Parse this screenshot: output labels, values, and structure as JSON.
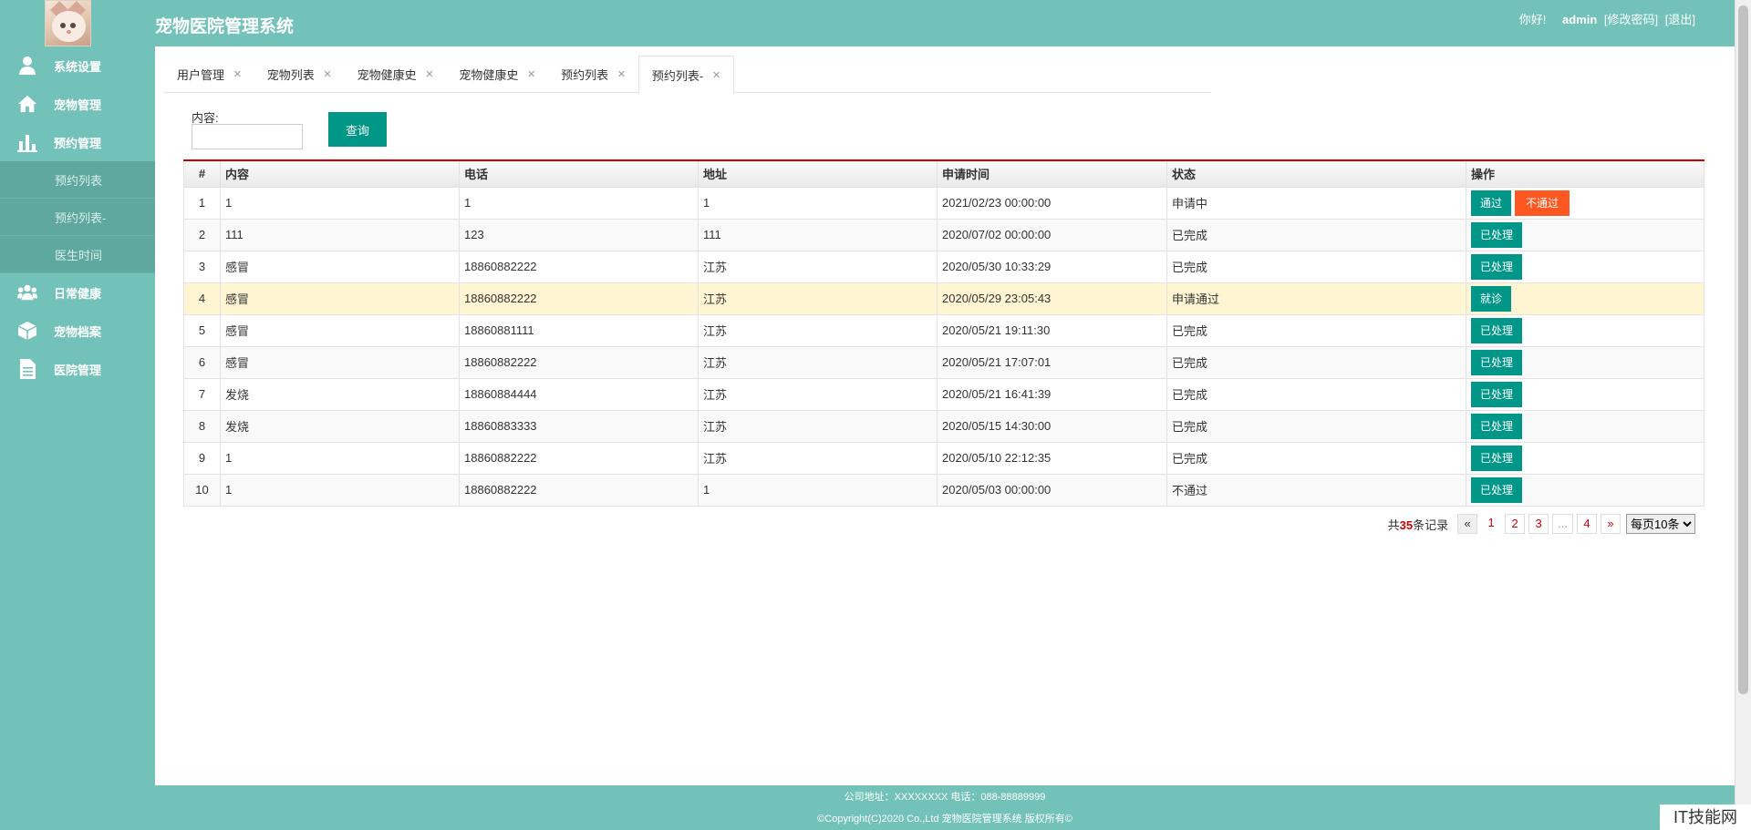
{
  "header": {
    "title": "宠物医院管理系统",
    "greeting": "你好!",
    "username": "admin",
    "change_password": "[修改密码]",
    "logout": "[退出]"
  },
  "sidebar": {
    "items": [
      {
        "label": "系统设置",
        "icon": "user-icon"
      },
      {
        "label": "宠物管理",
        "icon": "home-icon"
      },
      {
        "label": "预约管理",
        "icon": "bar-chart-icon"
      },
      {
        "label": "日常健康",
        "icon": "group-icon"
      },
      {
        "label": "宠物档案",
        "icon": "cube-icon"
      },
      {
        "label": "医院管理",
        "icon": "document-icon"
      }
    ],
    "subitems": [
      "预约列表",
      "预约列表-",
      "医生时间"
    ]
  },
  "tabs": [
    {
      "label": "用户管理"
    },
    {
      "label": "宠物列表"
    },
    {
      "label": "宠物健康史"
    },
    {
      "label": "宠物健康史"
    },
    {
      "label": "预约列表"
    },
    {
      "label": "预约列表-"
    }
  ],
  "search": {
    "label": "内容:",
    "value": "",
    "button": "查询"
  },
  "table": {
    "headers": [
      "#",
      "内容",
      "电话",
      "地址",
      "申请时间",
      "状态",
      "操作"
    ],
    "rows": [
      {
        "no": "1",
        "content": "1",
        "phone": "1",
        "address": "1",
        "time": "2021/02/23 00:00:00",
        "status": "申请中",
        "actions": [
          "通过",
          "不通过"
        ]
      },
      {
        "no": "2",
        "content": "111",
        "phone": "123",
        "address": "111",
        "time": "2020/07/02 00:00:00",
        "status": "已完成",
        "actions": [
          "已处理"
        ]
      },
      {
        "no": "3",
        "content": "感冒",
        "phone": "18860882222",
        "address": "江苏",
        "time": "2020/05/30 10:33:29",
        "status": "已完成",
        "actions": [
          "已处理"
        ]
      },
      {
        "no": "4",
        "content": "感冒",
        "phone": "18860882222",
        "address": "江苏",
        "time": "2020/05/29 23:05:43",
        "status": "申请通过",
        "actions": [
          "就诊"
        ]
      },
      {
        "no": "5",
        "content": "感冒",
        "phone": "18860881111",
        "address": "江苏",
        "time": "2020/05/21 19:11:30",
        "status": "已完成",
        "actions": [
          "已处理"
        ]
      },
      {
        "no": "6",
        "content": "感冒",
        "phone": "18860882222",
        "address": "江苏",
        "time": "2020/05/21 17:07:01",
        "status": "已完成",
        "actions": [
          "已处理"
        ]
      },
      {
        "no": "7",
        "content": "发烧",
        "phone": "18860884444",
        "address": "江苏",
        "time": "2020/05/21 16:41:39",
        "status": "已完成",
        "actions": [
          "已处理"
        ]
      },
      {
        "no": "8",
        "content": "发烧",
        "phone": "18860883333",
        "address": "江苏",
        "time": "2020/05/15 14:30:00",
        "status": "已完成",
        "actions": [
          "已处理"
        ]
      },
      {
        "no": "9",
        "content": "1",
        "phone": "18860882222",
        "address": "江苏",
        "time": "2020/05/10 22:12:35",
        "status": "已完成",
        "actions": [
          "已处理"
        ]
      },
      {
        "no": "10",
        "content": "1",
        "phone": "18860882222",
        "address": "1",
        "time": "2020/05/03 00:00:00",
        "status": "不通过",
        "actions": [
          "已处理"
        ]
      }
    ]
  },
  "pager": {
    "total_prefix": "共",
    "total": "35",
    "total_suffix": "条记录",
    "prev": "«",
    "pages": [
      "1",
      "2",
      "3",
      "...",
      "4"
    ],
    "next": "»",
    "page_size": "每页10条"
  },
  "footer": {
    "line1": "公司地址：XXXXXXXX 电话：088-88889999",
    "line2": "©Copyright(C)2020 Co.,Ltd 宠物医院管理系统 版权所有©"
  },
  "watermark": "IT技能网",
  "colors": {
    "primary": "#73c2b9",
    "button": "#009688",
    "danger": "#ff5722",
    "highlight_row": "#fff5d2"
  }
}
